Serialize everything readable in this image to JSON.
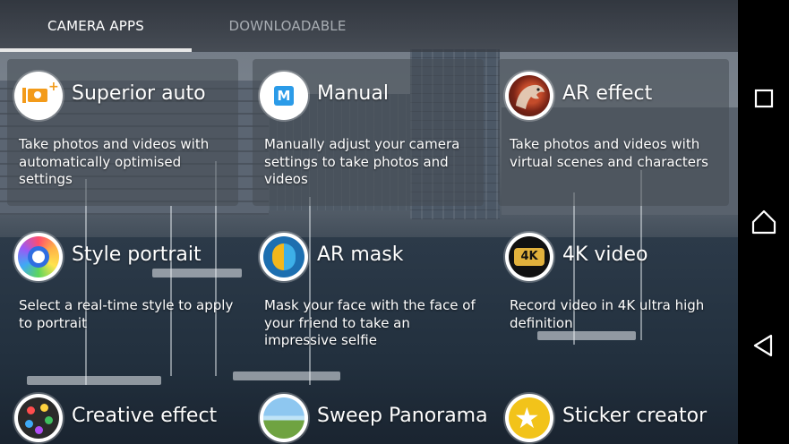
{
  "tabs": [
    {
      "label": "CAMERA APPS",
      "active": true
    },
    {
      "label": "DOWNLOADABLE",
      "active": false
    }
  ],
  "apps": [
    {
      "title": "Superior auto",
      "description": "Take photos and videos with automatically optimised settings",
      "icon": "auto-camera-icon"
    },
    {
      "title": "Manual",
      "description": "Manually adjust your camera settings to take photos and videos",
      "icon": "manual-m-icon"
    },
    {
      "title": "AR effect",
      "description": "Take photos and videos with virtual scenes and characters",
      "icon": "dinosaur-icon"
    },
    {
      "title": "Style portrait",
      "description": "Select a real-time style to apply to portrait",
      "icon": "style-portrait-icon"
    },
    {
      "title": "AR mask",
      "description": "Mask your face with the face of your friend to take an impressive selfie",
      "icon": "ar-mask-icon"
    },
    {
      "title": "4K video",
      "description": "Record video in 4K ultra high definition",
      "icon": "4k-icon"
    },
    {
      "title": "Creative effect",
      "description": "",
      "icon": "palette-icon"
    },
    {
      "title": "Sweep Panorama",
      "description": "",
      "icon": "panorama-icon"
    },
    {
      "title": "Sticker creator",
      "description": "",
      "icon": "sticker-star-icon"
    }
  ],
  "icon_texts": {
    "manual": "M",
    "fourk": "4K"
  },
  "navigation": {
    "recents": "recents-square-icon",
    "home": "home-icon",
    "back": "back-triangle-icon"
  },
  "colors": {
    "tab_active": "#ffffff",
    "tab_inactive": "#a8adb3",
    "underline": "#e8e8e8",
    "nav_background": "#000000",
    "accent_orange": "#f39b1a",
    "accent_blue": "#2b9be8"
  }
}
